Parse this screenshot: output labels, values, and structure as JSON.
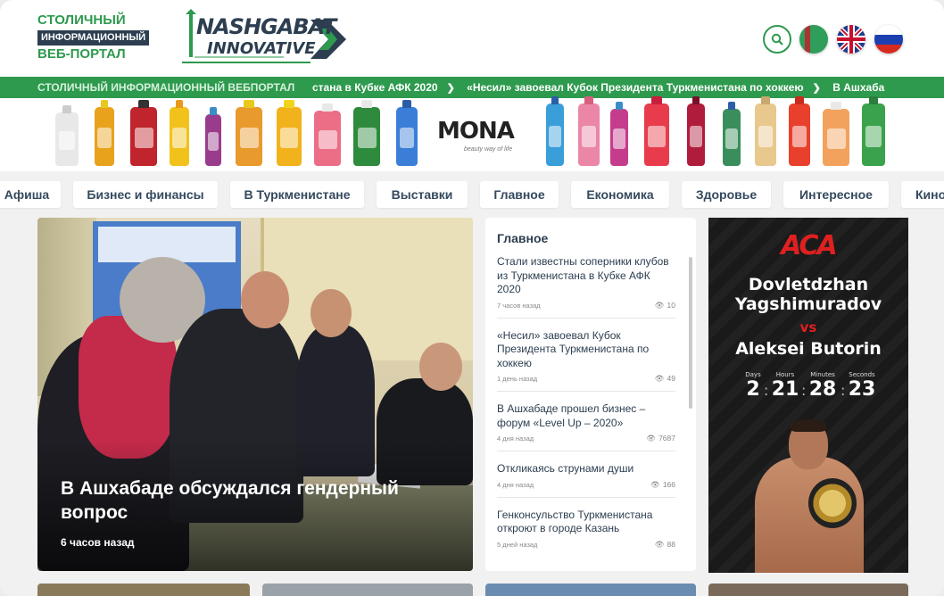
{
  "header": {
    "portal_logo": {
      "line1": "СТОЛИЧНЫЙ",
      "line2": "ИНФОРМАЦИОННЫЙ",
      "line3": "ВЕБ-ПОРТАЛ"
    },
    "brand_logo": {
      "line1": "NASHGABAT",
      "line2": "INNOVATIVE"
    },
    "icons": [
      "search-icon",
      "flag-turkmenistan-icon",
      "flag-uk-icon",
      "flag-russia-icon"
    ]
  },
  "ticker": {
    "label": "СТОЛИЧНЫЙ  ИНФОРМАЦИОННЫЙ  ВЕБПОРТАЛ",
    "items": [
      "стана в Кубке АФК 2020",
      "«Несил» завоевал Кубок Президента Туркменистана по хоккею",
      "В Ашхаба"
    ]
  },
  "ad_banner": {
    "brand": "MONA",
    "tagline": "beauty way of life"
  },
  "categories": [
    "Афиша",
    "Бизнес и финансы",
    "В Туркменистане",
    "Выставки",
    "Главное",
    "Економика",
    "Здоровье",
    "Интересное",
    "Кино"
  ],
  "hero": {
    "title": "В Ашхабаде обсуждался гендерный вопрос",
    "time": "6 часов назад"
  },
  "news": {
    "heading": "Главное",
    "items": [
      {
        "title": "Стали известны соперники клубов из Туркменистана в Кубке АФК 2020",
        "time": "7 часов назад",
        "views": "10"
      },
      {
        "title": "«Несил» завоевал Кубок Президента Туркменистана по хоккею",
        "time": "1 день назад",
        "views": "49"
      },
      {
        "title": "В Ашхабаде прошел бизнес – форум «Level Up – 2020»",
        "time": "4 дня назад",
        "views": "7687"
      },
      {
        "title": "Откликаясь струнами души",
        "time": "4 дня назад",
        "views": "166"
      },
      {
        "title": "Генконсульство Туркменистана откроют в городе Казань",
        "time": "5 дней назад",
        "views": "88"
      }
    ]
  },
  "promo": {
    "logo": "ACA",
    "fighter1_first": "Dovletdzhan",
    "fighter1_last": "Yagshimuradov",
    "vs": "vs",
    "fighter2": "Aleksei Butorin",
    "countdown": [
      {
        "label": "Days",
        "value": "2"
      },
      {
        "label": "Hours",
        "value": "21"
      },
      {
        "label": "Minutes",
        "value": "28"
      },
      {
        "label": "Seconds",
        "value": "23"
      }
    ]
  },
  "colors": {
    "brand_green": "#2e9a4e",
    "navy": "#2c3e50",
    "aca_red": "#e02020"
  }
}
